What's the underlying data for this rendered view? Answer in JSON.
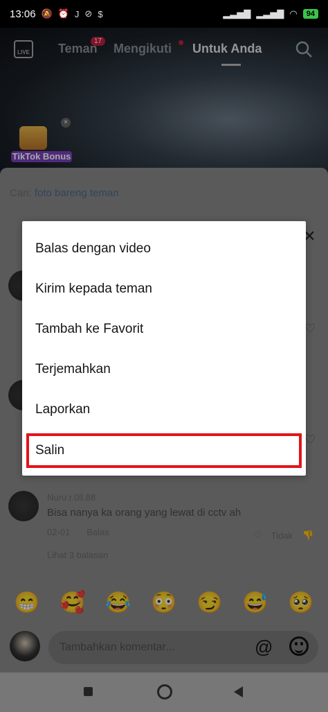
{
  "status_bar": {
    "time": "13:06",
    "battery": "94"
  },
  "top_nav": {
    "live_label": "LIVE",
    "tabs": [
      {
        "label": "Teman",
        "badge": "17"
      },
      {
        "label": "Mengikuti"
      },
      {
        "label": "Untuk Anda",
        "active": true
      }
    ]
  },
  "promo": {
    "label": "TikTok Bonus"
  },
  "comments_sheet": {
    "hint_prefix": "Cari:",
    "hint_link": "foto bareng teman",
    "comment": {
      "name": "Nuru r.0ll.88",
      "text": "Bisa nanya ka orang yang lewat di cctv ah",
      "date": "02-01",
      "reply_label": "Balas",
      "like_count": "Tidak",
      "view_replies": "Lihat 3 balasan"
    }
  },
  "emoji_row": [
    "😁",
    "🥰",
    "😂",
    "😳",
    "😏",
    "😅",
    "🥺"
  ],
  "comment_input": {
    "placeholder": "Tambahkan komentar..."
  },
  "menu": {
    "items": [
      {
        "label": "Balas dengan video"
      },
      {
        "label": "Kirim kepada teman"
      },
      {
        "label": "Tambah ke Favorit"
      },
      {
        "label": "Terjemahkan"
      },
      {
        "label": "Laporkan"
      },
      {
        "label": "Salin",
        "highlighted": true
      }
    ]
  },
  "colors": {
    "highlight_border": "#e0161b",
    "badge": "#c41f3c"
  }
}
